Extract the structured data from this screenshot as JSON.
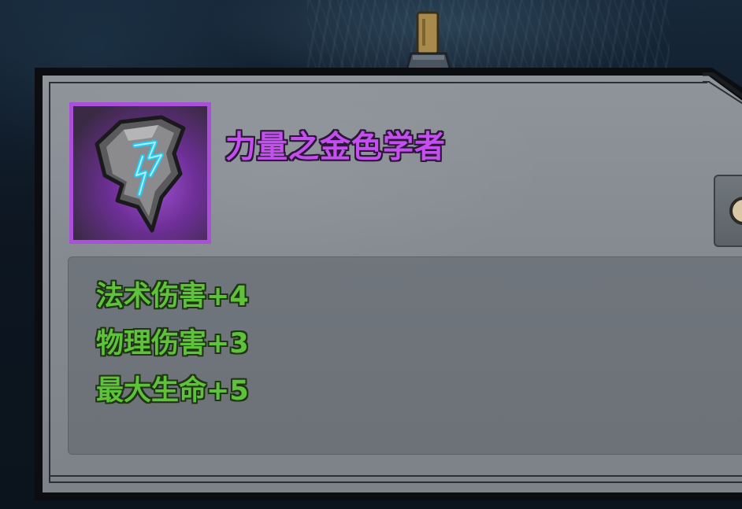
{
  "item": {
    "name": "力量之金色学者",
    "rarity_color": "#c44ef0",
    "icon": "rune-stone-icon"
  },
  "stats": [
    {
      "text": "法术伤害+4"
    },
    {
      "text": "物理伤害+3"
    },
    {
      "text": "最大生命+5"
    }
  ],
  "colors": {
    "stat_text": "#5ec23a",
    "frame_border": "#a94fd8",
    "panel_bg": "#868c92"
  },
  "side_button": {
    "icon": "coin-icon"
  }
}
